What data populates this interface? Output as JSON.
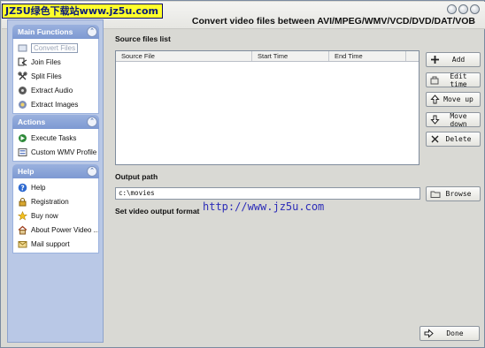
{
  "watermark": {
    "top": "JZ5U绿色下载站www.jz5u.com",
    "url": "http://www.jz5u.com"
  },
  "app": {
    "title": "Convert video files between AVI/MPEG/WMV/VCD/DVD/DAT/VOB"
  },
  "sidebar": {
    "sections": [
      {
        "title": "Main Functions",
        "items": [
          {
            "label": "Convert Files",
            "icon": "convert-icon",
            "selected": true
          },
          {
            "label": "Join Files",
            "icon": "join-icon"
          },
          {
            "label": "Split Files",
            "icon": "split-icon"
          },
          {
            "label": "Extract Audio",
            "icon": "audio-icon"
          },
          {
            "label": "Extract Images",
            "icon": "image-icon"
          }
        ]
      },
      {
        "title": "Actions",
        "items": [
          {
            "label": "Execute Tasks",
            "icon": "execute-icon"
          },
          {
            "label": "Custom WMV Profile",
            "icon": "profile-icon"
          }
        ]
      },
      {
        "title": "Help",
        "items": [
          {
            "label": "Help",
            "icon": "help-icon"
          },
          {
            "label": "Registration",
            "icon": "registration-icon"
          },
          {
            "label": "Buy now",
            "icon": "buy-icon"
          },
          {
            "label": "About Power Video ...",
            "icon": "home-icon"
          },
          {
            "label": "Mail support",
            "icon": "mail-icon"
          }
        ]
      }
    ]
  },
  "main": {
    "source_label": "Source files list",
    "columns": [
      "Source File",
      "Start Time",
      "End Time"
    ],
    "rows": [],
    "output_label": "Output path",
    "output_path": "c:\\movies",
    "format_label": "Set video output format",
    "buttons": {
      "add": "Add",
      "edit_time": "Edit time",
      "move_up": "Move up",
      "move_down": "Move down",
      "delete": "Delete",
      "browse": "Browse",
      "done": "Done"
    }
  },
  "colors": {
    "sidebar_bg": "#b9c8e6",
    "section_header": "#7d99d2",
    "watermark_bg": "#ffff2a",
    "watermark_url": "#2c2cb8"
  }
}
